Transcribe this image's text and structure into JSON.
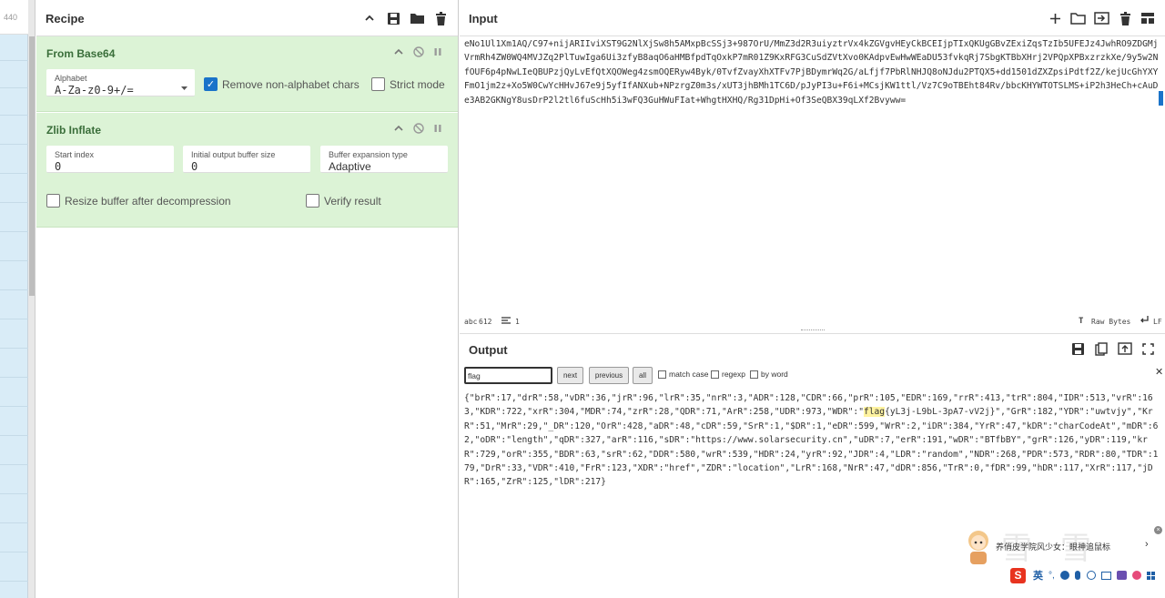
{
  "left": {
    "line_number": "440"
  },
  "recipe": {
    "title": "Recipe",
    "ops": [
      {
        "name": "From Base64",
        "alphabet_label": "Alphabet",
        "alphabet_value": "A-Za-z0-9+/=",
        "remove_label": "Remove non-alphabet chars",
        "strict_label": "Strict mode"
      },
      {
        "name": "Zlib Inflate",
        "start_label": "Start index",
        "start_value": "0",
        "buffer_label": "Initial output buffer size",
        "buffer_value": "0",
        "expansion_label": "Buffer expansion type",
        "expansion_value": "Adaptive",
        "resize_label": "Resize buffer after decompression",
        "verify_label": "Verify result"
      }
    ]
  },
  "input": {
    "title": "Input",
    "text": "eNo1Ul1Xm1AQ/C97+nijARIIviXST9G2NlXjSw8h5AMxpBcSSj3+987OrU/MmZ3d2R3uiyztrVx4kZGVgvHEyCkBCEIjpTIxQKUgGBvZExiZqsTzIb5UFEJz4JwhRO9ZDGMjVrmRh4ZW0WQ4MVJZq2PlTuwIga6Ui3zfyB8aqO6aHMBfpdTqOxkP7mR01Z9KxRFG3CuSdZVtXvo0KAdpvEwHwWEaDU53fvkqRj7SbgKTBbXHrj2VPQpXPBxzrzkXe/9y5w2NfOUF6p4pNwLIeQBUPzjQyLvEfQtXQOWeg4zsmOQERyw4Byk/0TvfZvayXhXTFv7PjBDymrWq2G/aLfjf7PbRlNHJQ8oNJdu2PTQX5+dd1501dZXZpsiPdtf2Z/kejUcGhYXYFmO1jm2z+Xo5W0CwYcHHvJ67e9j5yfIfANXub+NPzrgZ0m3s/xUT3jhBMh1TC6D/pJyPI3u+F6i+MCsjKW1ttl/Vz7C9oTBEht84Rv/bbcKHYWTOTSLMS+iP2h3HeCh+cAuDe3AB2GKNgY8usDrP2l2tl6fuScHh5i3wFQ3GuHWuFIat+WhgtHXHQ/Rg31DpHi+Of3SeQBX39qLXf2Bvyww=",
    "char_count": "612",
    "line_count": "1",
    "raw_bytes_label": "Raw Bytes",
    "eol_label": "LF"
  },
  "output": {
    "title": "Output",
    "search_value": "flag",
    "next_label": "next",
    "previous_label": "previous",
    "all_label": "all",
    "match_case_label": "match case",
    "regexp_label": "regexp",
    "by_word_label": "by word",
    "text_before": "{\"brR\":17,\"drR\":58,\"vDR\":36,\"jrR\":96,\"lrR\":35,\"nrR\":3,\"ADR\":128,\"CDR\":66,\"prR\":105,\"EDR\":169,\"rrR\":413,\"trR\":804,\"IDR\":513,\"vrR\":163,\"KDR\":722,\"xrR\":304,\"MDR\":74,\"zrR\":28,\"QDR\":71,\"ArR\":258,\"UDR\":973,\"WDR\":\"",
    "text_match": "flag",
    "text_after": "{yL3j-L9bL-3pA7-vV2j}\",\"GrR\":182,\"YDR\":\"uwtvjy\",\"KrR\":51,\"MrR\":29,\"_DR\":120,\"OrR\":428,\"aDR\":48,\"cDR\":59,\"SrR\":1,\"$DR\":1,\"eDR\":599,\"WrR\":2,\"iDR\":384,\"YrR\":47,\"kDR\":\"charCodeAt\",\"mDR\":62,\"oDR\":\"length\",\"qDR\":327,\"arR\":116,\"sDR\":\"https://www.solarsecurity.cn\",\"uDR\":7,\"erR\":191,\"wDR\":\"BTfbBY\",\"grR\":126,\"yDR\":119,\"krR\":729,\"orR\":355,\"BDR\":63,\"srR\":62,\"DDR\":580,\"wrR\":539,\"HDR\":24,\"yrR\":92,\"JDR\":4,\"LDR\":\"random\",\"NDR\":268,\"PDR\":573,\"RDR\":80,\"TDR\":179,\"DrR\":33,\"VDR\":410,\"FrR\":123,\"XDR\":\"href\",\"ZDR\":\"location\",\"LrR\":168,\"NrR\":47,\"dDR\":856,\"TrR\":0,\"fDR\":99,\"hDR\":117,\"XrR\":117,\"jDR\":165,\"ZrR\":125,\"lDR\":217}"
  },
  "widget": {
    "caption": "养俏皮学院风少女：眼神追鼠标",
    "ime_label": "英"
  }
}
